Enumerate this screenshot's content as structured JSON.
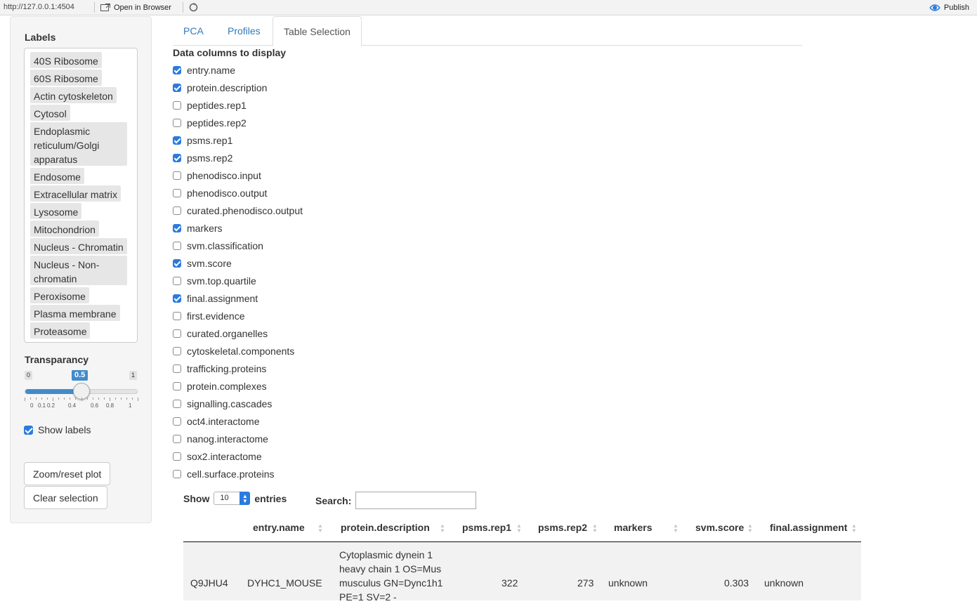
{
  "toolbar": {
    "url": "http://127.0.0.1:4504",
    "open_in_browser": "Open in Browser",
    "publish": "Publish"
  },
  "sidebar": {
    "labels_heading": "Labels",
    "labels": [
      "40S Ribosome",
      "60S Ribosome",
      "Actin cytoskeleton",
      "Cytosol",
      "Endoplasmic reticulum/Golgi apparatus",
      "Endosome",
      "Extracellular matrix",
      "Lysosome",
      "Mitochondrion",
      "Nucleus - Chromatin",
      "Nucleus - Non-chromatin",
      "Peroxisome",
      "Plasma membrane",
      "Proteasome"
    ],
    "transparency": {
      "heading": "Transparancy",
      "min": "0",
      "max": "1",
      "value": 0.5,
      "value_label": "0.5",
      "tick_labels": [
        "0",
        "0.1",
        "0.2",
        "0.4",
        "0.6",
        "0.8",
        "1"
      ]
    },
    "show_labels": {
      "label": "Show labels",
      "checked": true
    },
    "zoom_button": "Zoom/reset plot",
    "clear_button": "Clear selection"
  },
  "tabs": [
    {
      "label": "PCA",
      "active": false
    },
    {
      "label": "Profiles",
      "active": false
    },
    {
      "label": "Table Selection",
      "active": true
    }
  ],
  "columns": {
    "heading": "Data columns to display",
    "items": [
      {
        "label": "entry.name",
        "checked": true
      },
      {
        "label": "protein.description",
        "checked": true
      },
      {
        "label": "peptides.rep1",
        "checked": false
      },
      {
        "label": "peptides.rep2",
        "checked": false
      },
      {
        "label": "psms.rep1",
        "checked": true
      },
      {
        "label": "psms.rep2",
        "checked": true
      },
      {
        "label": "phenodisco.input",
        "checked": false
      },
      {
        "label": "phenodisco.output",
        "checked": false
      },
      {
        "label": "curated.phenodisco.output",
        "checked": false
      },
      {
        "label": "markers",
        "checked": true
      },
      {
        "label": "svm.classification",
        "checked": false
      },
      {
        "label": "svm.score",
        "checked": true
      },
      {
        "label": "svm.top.quartile",
        "checked": false
      },
      {
        "label": "final.assignment",
        "checked": true
      },
      {
        "label": "first.evidence",
        "checked": false
      },
      {
        "label": "curated.organelles",
        "checked": false
      },
      {
        "label": "cytoskeletal.components",
        "checked": false
      },
      {
        "label": "trafficking.proteins",
        "checked": false
      },
      {
        "label": "protein.complexes",
        "checked": false
      },
      {
        "label": "signalling.cascades",
        "checked": false
      },
      {
        "label": "oct4.interactome",
        "checked": false
      },
      {
        "label": "nanog.interactome",
        "checked": false
      },
      {
        "label": "sox2.interactome",
        "checked": false
      },
      {
        "label": "cell.surface.proteins",
        "checked": false
      }
    ]
  },
  "table": {
    "show_label": "Show",
    "entries_value": "10",
    "entries_label": "entries",
    "search_label": "Search:",
    "search_value": "",
    "headers": [
      "entry.name",
      "protein.description",
      "psms.rep1",
      "psms.rep2",
      "markers",
      "svm.score",
      "final.assignment"
    ],
    "rows": [
      {
        "id": "Q9JHU4",
        "entry_name": "DYHC1_MOUSE",
        "description_lines": [
          "Cytoplasmic dynein 1",
          "heavy chain 1 OS=Mus",
          "musculus GN=Dync1h1",
          "PE=1 SV=2 -"
        ],
        "psms_rep1": "322",
        "psms_rep2": "273",
        "markers": "unknown",
        "svm_score": "0.303",
        "final_assignment": "unknown"
      }
    ]
  },
  "colors": {
    "accent": "#428bca",
    "checkbox": "#2a7bde",
    "link": "#337ab7"
  }
}
